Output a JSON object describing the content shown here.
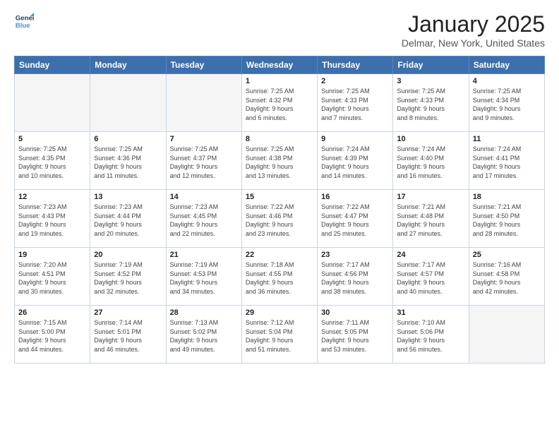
{
  "logo": {
    "line1": "General",
    "line2": "Blue"
  },
  "header": {
    "title": "January 2025",
    "location": "Delmar, New York, United States"
  },
  "days_of_week": [
    "Sunday",
    "Monday",
    "Tuesday",
    "Wednesday",
    "Thursday",
    "Friday",
    "Saturday"
  ],
  "weeks": [
    [
      {
        "day": "",
        "content": ""
      },
      {
        "day": "",
        "content": ""
      },
      {
        "day": "",
        "content": ""
      },
      {
        "day": "1",
        "content": "Sunrise: 7:25 AM\nSunset: 4:32 PM\nDaylight: 9 hours\nand 6 minutes."
      },
      {
        "day": "2",
        "content": "Sunrise: 7:25 AM\nSunset: 4:33 PM\nDaylight: 9 hours\nand 7 minutes."
      },
      {
        "day": "3",
        "content": "Sunrise: 7:25 AM\nSunset: 4:33 PM\nDaylight: 9 hours\nand 8 minutes."
      },
      {
        "day": "4",
        "content": "Sunrise: 7:25 AM\nSunset: 4:34 PM\nDaylight: 9 hours\nand 9 minutes."
      }
    ],
    [
      {
        "day": "5",
        "content": "Sunrise: 7:25 AM\nSunset: 4:35 PM\nDaylight: 9 hours\nand 10 minutes."
      },
      {
        "day": "6",
        "content": "Sunrise: 7:25 AM\nSunset: 4:36 PM\nDaylight: 9 hours\nand 11 minutes."
      },
      {
        "day": "7",
        "content": "Sunrise: 7:25 AM\nSunset: 4:37 PM\nDaylight: 9 hours\nand 12 minutes."
      },
      {
        "day": "8",
        "content": "Sunrise: 7:25 AM\nSunset: 4:38 PM\nDaylight: 9 hours\nand 13 minutes."
      },
      {
        "day": "9",
        "content": "Sunrise: 7:24 AM\nSunset: 4:39 PM\nDaylight: 9 hours\nand 14 minutes."
      },
      {
        "day": "10",
        "content": "Sunrise: 7:24 AM\nSunset: 4:40 PM\nDaylight: 9 hours\nand 16 minutes."
      },
      {
        "day": "11",
        "content": "Sunrise: 7:24 AM\nSunset: 4:41 PM\nDaylight: 9 hours\nand 17 minutes."
      }
    ],
    [
      {
        "day": "12",
        "content": "Sunrise: 7:23 AM\nSunset: 4:43 PM\nDaylight: 9 hours\nand 19 minutes."
      },
      {
        "day": "13",
        "content": "Sunrise: 7:23 AM\nSunset: 4:44 PM\nDaylight: 9 hours\nand 20 minutes."
      },
      {
        "day": "14",
        "content": "Sunrise: 7:23 AM\nSunset: 4:45 PM\nDaylight: 9 hours\nand 22 minutes."
      },
      {
        "day": "15",
        "content": "Sunrise: 7:22 AM\nSunset: 4:46 PM\nDaylight: 9 hours\nand 23 minutes."
      },
      {
        "day": "16",
        "content": "Sunrise: 7:22 AM\nSunset: 4:47 PM\nDaylight: 9 hours\nand 25 minutes."
      },
      {
        "day": "17",
        "content": "Sunrise: 7:21 AM\nSunset: 4:48 PM\nDaylight: 9 hours\nand 27 minutes."
      },
      {
        "day": "18",
        "content": "Sunrise: 7:21 AM\nSunset: 4:50 PM\nDaylight: 9 hours\nand 28 minutes."
      }
    ],
    [
      {
        "day": "19",
        "content": "Sunrise: 7:20 AM\nSunset: 4:51 PM\nDaylight: 9 hours\nand 30 minutes."
      },
      {
        "day": "20",
        "content": "Sunrise: 7:19 AM\nSunset: 4:52 PM\nDaylight: 9 hours\nand 32 minutes."
      },
      {
        "day": "21",
        "content": "Sunrise: 7:19 AM\nSunset: 4:53 PM\nDaylight: 9 hours\nand 34 minutes."
      },
      {
        "day": "22",
        "content": "Sunrise: 7:18 AM\nSunset: 4:55 PM\nDaylight: 9 hours\nand 36 minutes."
      },
      {
        "day": "23",
        "content": "Sunrise: 7:17 AM\nSunset: 4:56 PM\nDaylight: 9 hours\nand 38 minutes."
      },
      {
        "day": "24",
        "content": "Sunrise: 7:17 AM\nSunset: 4:57 PM\nDaylight: 9 hours\nand 40 minutes."
      },
      {
        "day": "25",
        "content": "Sunrise: 7:16 AM\nSunset: 4:58 PM\nDaylight: 9 hours\nand 42 minutes."
      }
    ],
    [
      {
        "day": "26",
        "content": "Sunrise: 7:15 AM\nSunset: 5:00 PM\nDaylight: 9 hours\nand 44 minutes."
      },
      {
        "day": "27",
        "content": "Sunrise: 7:14 AM\nSunset: 5:01 PM\nDaylight: 9 hours\nand 46 minutes."
      },
      {
        "day": "28",
        "content": "Sunrise: 7:13 AM\nSunset: 5:02 PM\nDaylight: 9 hours\nand 49 minutes."
      },
      {
        "day": "29",
        "content": "Sunrise: 7:12 AM\nSunset: 5:04 PM\nDaylight: 9 hours\nand 51 minutes."
      },
      {
        "day": "30",
        "content": "Sunrise: 7:11 AM\nSunset: 5:05 PM\nDaylight: 9 hours\nand 53 minutes."
      },
      {
        "day": "31",
        "content": "Sunrise: 7:10 AM\nSunset: 5:06 PM\nDaylight: 9 hours\nand 56 minutes."
      },
      {
        "day": "",
        "content": ""
      }
    ]
  ]
}
